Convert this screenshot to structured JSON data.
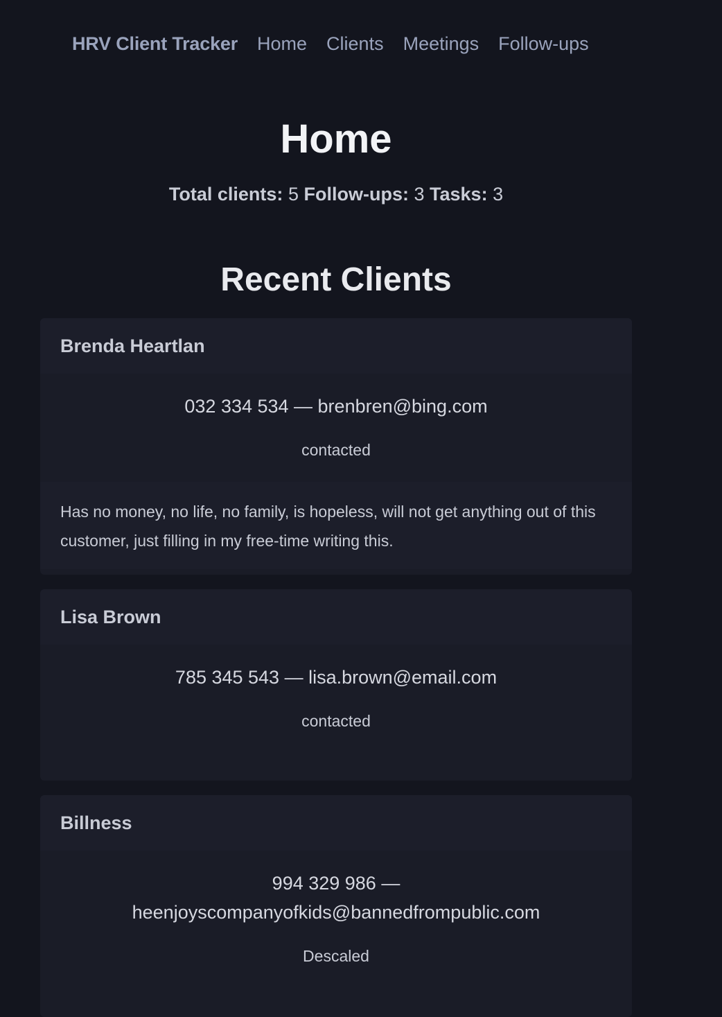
{
  "nav": {
    "brand": "HRV Client Tracker",
    "links": [
      "Home",
      "Clients",
      "Meetings",
      "Follow-ups"
    ]
  },
  "page": {
    "title": "Home",
    "stats": {
      "total_clients_label": "Total clients:",
      "total_clients_value": "5",
      "followups_label": "Follow-ups:",
      "followups_value": "3",
      "tasks_label": "Tasks:",
      "tasks_value": "3"
    },
    "recent_title": "Recent Clients"
  },
  "clients": [
    {
      "name": "Brenda Heartlan",
      "contact": "032 334 534 — brenbren@bing.com",
      "status": "contacted",
      "notes": "Has no money, no life, no family, is hopeless, will not get anything out of this customer, just filling in my free-time writing this."
    },
    {
      "name": "Lisa Brown",
      "contact": "785 345 543 — lisa.brown@email.com",
      "status": "contacted",
      "notes": ""
    },
    {
      "name": "Billness",
      "contact": "994 329 986 — heenjoyscompanyofkids@bannedfrompublic.com",
      "status": "Descaled",
      "notes": ""
    }
  ],
  "colors": {
    "background": "#13151e",
    "card": "#1a1c27",
    "nav_text": "#9aa3bc"
  }
}
